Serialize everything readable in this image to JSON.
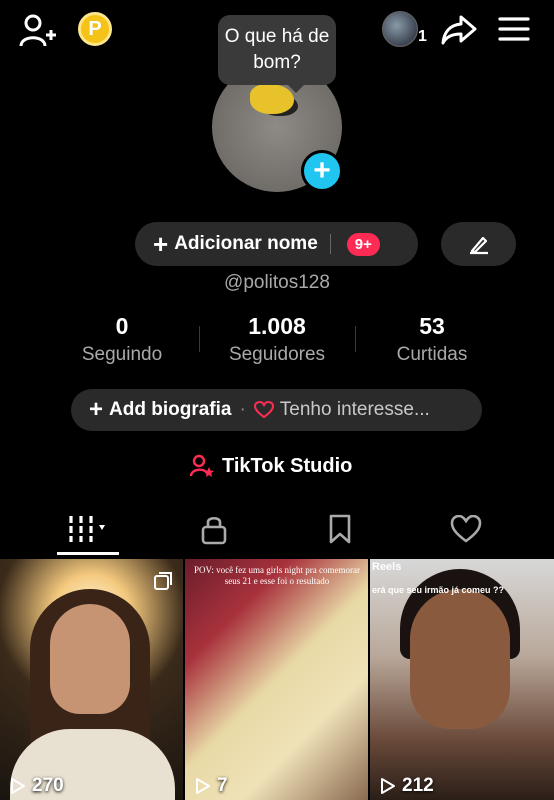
{
  "header": {
    "coin_letter": "P",
    "mini_count": "1",
    "tooltip": "O que há de bom?"
  },
  "profile": {
    "add_name_label": "Adicionar nome",
    "badge": "9+",
    "username": "@politos128"
  },
  "stats": [
    {
      "value": "0",
      "label": "Seguindo"
    },
    {
      "value": "1.008",
      "label": "Seguidores"
    },
    {
      "value": "53",
      "label": "Curtidas"
    }
  ],
  "bio": {
    "add_label": "Add biografia",
    "separator": "·",
    "interest": "Tenho interesse..."
  },
  "studio": {
    "label": "TikTok Studio"
  },
  "tabs": [
    {
      "icon": "grid-icon",
      "active": true
    },
    {
      "icon": "lock-icon"
    },
    {
      "icon": "bookmark-icon"
    },
    {
      "icon": "heart-icon"
    }
  ],
  "videos": [
    {
      "views": "270"
    },
    {
      "views": "7",
      "caption": "POV: você fez uma girls night pra comemorar seus 21 e esse foi o resultado"
    },
    {
      "views": "212",
      "tag": "Reels",
      "caption": "erá que seu irmão já comeu ??"
    }
  ],
  "colors": {
    "accent": "#fe2c55",
    "add_photo": "#20c5f0",
    "pill_bg": "#2a2a2a",
    "coin": "#f5c218"
  }
}
